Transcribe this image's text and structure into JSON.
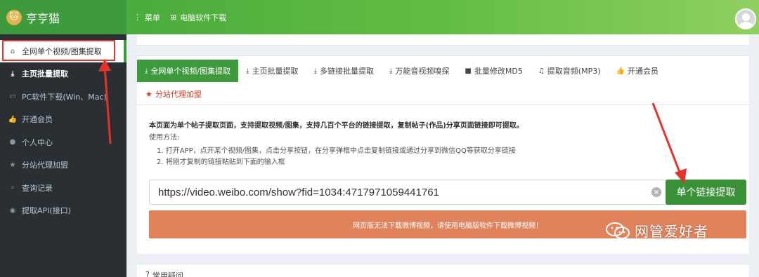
{
  "header": {
    "brand_title": "亨亨猫",
    "logo_icon": "cat-face-icon",
    "nav": [
      {
        "icon": "menu-dots-icon",
        "label": "菜单"
      },
      {
        "icon": "windows-apple-icon",
        "label": "电脑软件下载"
      }
    ]
  },
  "sidebar": {
    "items": [
      {
        "icon": "home-icon",
        "label": "全网单个视频/图集提取"
      },
      {
        "icon": "download-icon",
        "label": "主页批量提取"
      },
      {
        "icon": "desktop-icon",
        "label": "PC软件下载(Win、Mac)"
      },
      {
        "icon": "thumbs-up-icon",
        "label": "开通会员"
      },
      {
        "icon": "user-icon",
        "label": "个人中心"
      },
      {
        "icon": "star-icon",
        "label": "分站代理加盟"
      },
      {
        "icon": "search-icon",
        "label": "查询记录"
      },
      {
        "icon": "github-icon",
        "label": "提取API(接口)"
      }
    ]
  },
  "tabs": [
    {
      "icon": "download-icon",
      "label": "全网单个视频/图集提取"
    },
    {
      "icon": "download-icon",
      "label": "主页批量提取"
    },
    {
      "icon": "download-icon",
      "label": "多链接批量提取"
    },
    {
      "icon": "download-icon",
      "label": "万能音视频嗅探"
    },
    {
      "icon": "video-camera-icon",
      "label": "批量修改MD5"
    },
    {
      "icon": "music-icon",
      "label": "提取音频(MP3)"
    },
    {
      "icon": "thumbs-up-icon",
      "label": "开通会员"
    }
  ],
  "tab_extra": {
    "icon": "star-icon",
    "label": "分站代理加盟"
  },
  "description": {
    "intro": "本页面为单个帖子提取页面，支持提取视频/图集，支持几百个平台的链接提取，复制帖子(作品)分享页面链接即可提取。",
    "howto_title": "使用方法:",
    "steps": [
      "1. 打开APP，点开某个视频/图集，点击分享按钮，在分享弹框中点击复制链接或通过分享到微信QQ等获取分享链接",
      "2. 将刚才复制的链接粘贴到下面的输入框"
    ]
  },
  "input": {
    "value": "https://video.weibo.com/show?fid=1034:4717971059441761"
  },
  "submit_label": "单个链接提取",
  "warning": "网页版无法下载微博视频，请使用电脑版软件下载微博视频！",
  "watermark": "网管爱好者",
  "faq_title": "常用疑问",
  "colors": {
    "accent": "#3d9a3d",
    "sidebar_bg": "#2a2f33",
    "warning": "#e0835c",
    "annotation_red": "#e8312a"
  }
}
